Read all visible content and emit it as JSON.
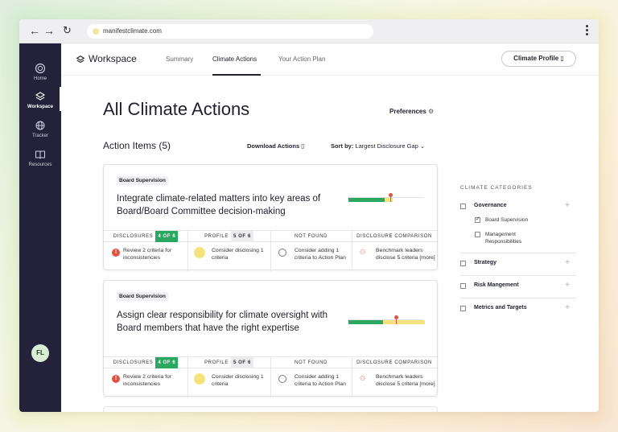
{
  "browser": {
    "url": "manifestclimate.com"
  },
  "sidebar": {
    "items": [
      {
        "label": "Home",
        "icon": "home-icon"
      },
      {
        "label": "Workspace",
        "icon": "layers-icon"
      },
      {
        "label": "Tracker",
        "icon": "globe-icon"
      },
      {
        "label": "Resources",
        "icon": "book-icon"
      }
    ],
    "avatar": "FL"
  },
  "header": {
    "title": "Workspace",
    "tabs": [
      "Summary",
      "Climate Actions",
      "Your Action Plan"
    ],
    "active_tab": "Climate Actions",
    "profile_button": "Climate Profile"
  },
  "main": {
    "title": "All Climate Actions",
    "preferences": "Preferences",
    "action_items": "Action Items (5)",
    "download": "Download Actions",
    "sort_label": "Sort by:",
    "sort_value": "Largest Disclosure Gap"
  },
  "cards": [
    {
      "tag": "Board Supervision",
      "title": "Integrate climate-related matters into key areas of Board/Board Committee decision-making",
      "col_disclosures": "DISCLOSURES",
      "disclosures_badge": "4 OF 6",
      "col_profile": "PROFILE",
      "profile_badge": "5 OF 6",
      "col_notfound": "NOT FOUND",
      "col_comparison": "DISCLOSURE COMPARISON",
      "disclosures_text": "Review 2 criteria for inconsistencies",
      "profile_text": "Consider disclosing 1 criteria",
      "notfound_text": "Consider adding 1 criteria to Action Plan",
      "comparison_text": "Benchmark leaders disclose 5 criteria [more]",
      "gap": {
        "green": 0.47,
        "yellow": 0.11,
        "pin": 0.55
      }
    },
    {
      "tag": "Board Supervision",
      "title": "Assign clear responsibility for climate oversight with Board members that have the right expertise",
      "col_disclosures": "DISCLOSURES",
      "disclosures_badge": "4 OF 6",
      "col_profile": "PROFILE",
      "profile_badge": "5 OF 6",
      "col_notfound": "NOT FOUND",
      "col_comparison": "DISCLOSURE COMPARISON",
      "disclosures_text": "Review 2 criteria for inconsistencies",
      "profile_text": "Consider disclosing 1 criteria",
      "notfound_text": "Consider adding 1 criteria to Action Plan",
      "comparison_text": "Benchmark leaders disclose 5 criteria [more]",
      "gap": {
        "green": 0.45,
        "yellow": 0.55,
        "pin": 0.62
      }
    }
  ],
  "categories": {
    "title": "CLIMATE CATEGORIES",
    "items": [
      "Governance",
      "Strategy",
      "Risk Mangement",
      "Metrics and Targets"
    ],
    "governance_subs": [
      "Board Supervision",
      "Management Responsibilities"
    ]
  },
  "colors": {
    "sidebar": "#24213a",
    "green": "#2aa860",
    "yellow": "#f4e27c",
    "red": "#e2523f"
  }
}
